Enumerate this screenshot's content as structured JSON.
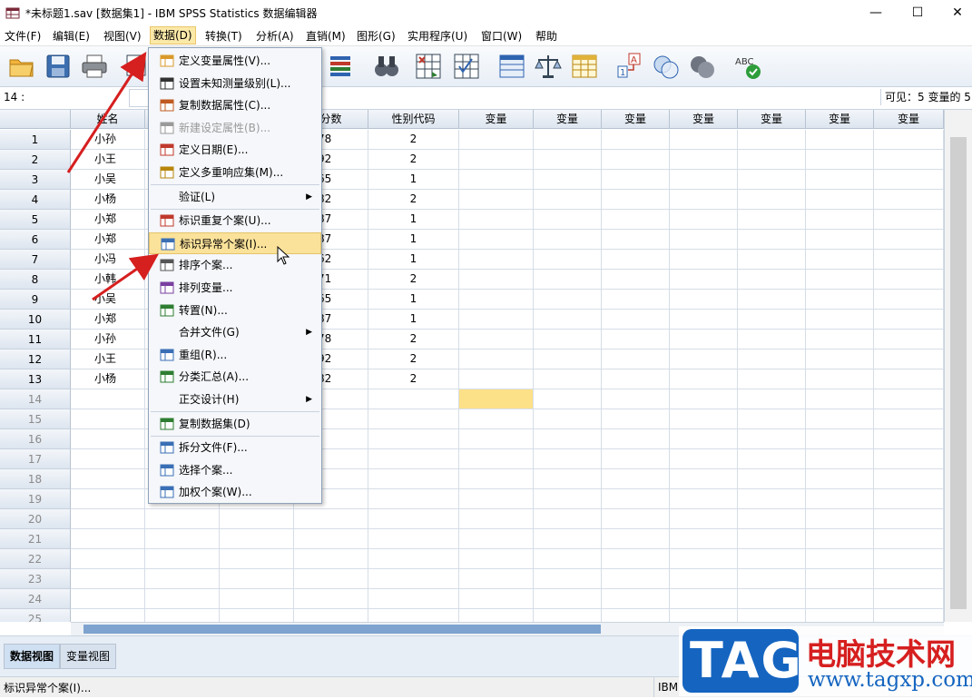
{
  "window": {
    "title": "*未标题1.sav [数据集1] - IBM SPSS Statistics 数据编辑器",
    "minimize_glyph": "—",
    "maximize_glyph": "☐",
    "close_glyph": "✕"
  },
  "menubar": {
    "items": [
      "文件(F)",
      "编辑(E)",
      "视图(V)",
      "数据(D)",
      "转换(T)",
      "分析(A)",
      "直销(M)",
      "图形(G)",
      "实用程序(U)",
      "窗口(W)",
      "帮助"
    ]
  },
  "refbar": {
    "cell_ref": "14 :",
    "visible": "可见：5 变量的 5"
  },
  "grid": {
    "headers": [
      "姓名",
      "",
      "",
      "分数",
      "性别代码",
      "变量",
      "变量",
      "变量",
      "变量",
      "变量",
      "变量",
      "变量"
    ],
    "rows": [
      {
        "num": "1",
        "name": "小孙",
        "score": "78",
        "gender": "2"
      },
      {
        "num": "2",
        "name": "小王",
        "score": "92",
        "gender": "2"
      },
      {
        "num": "3",
        "name": "小吴",
        "score": "65",
        "gender": "1"
      },
      {
        "num": "4",
        "name": "小杨",
        "score": "82",
        "gender": "2"
      },
      {
        "num": "5",
        "name": "小郑",
        "score": "87",
        "gender": "1"
      },
      {
        "num": "6",
        "name": "小郑",
        "score": "87",
        "gender": "1"
      },
      {
        "num": "7",
        "name": "小冯",
        "score": "62",
        "gender": "1"
      },
      {
        "num": "8",
        "name": "小韩",
        "score": "71",
        "gender": "2"
      },
      {
        "num": "9",
        "name": "小吴",
        "score": "65",
        "gender": "1"
      },
      {
        "num": "10",
        "name": "小郑",
        "score": "87",
        "gender": "1"
      },
      {
        "num": "11",
        "name": "小孙",
        "score": "78",
        "gender": "2"
      },
      {
        "num": "12",
        "name": "小王",
        "score": "92",
        "gender": "2"
      },
      {
        "num": "13",
        "name": "小杨",
        "score": "82",
        "gender": "2"
      }
    ],
    "empty_rows": [
      "14",
      "15",
      "16",
      "17",
      "18",
      "19",
      "20",
      "21",
      "22",
      "23",
      "24",
      "25"
    ]
  },
  "dropdown": {
    "items": [
      {
        "label": "定义变量属性(V)...",
        "icon": "define-var-icon",
        "color": "#d99a2b"
      },
      {
        "label": "设置未知测量级别(L)...",
        "icon": "unknown-measure-icon",
        "color": "#333333"
      },
      {
        "label": "复制数据属性(C)...",
        "icon": "copy-props-icon",
        "color": "#c05a20"
      },
      {
        "label": "新建设定属性(B)...",
        "icon": "new-attr-icon",
        "color": "#9a9a9a",
        "disabled": true
      },
      {
        "label": "定义日期(E)...",
        "icon": "define-date-icon",
        "color": "#c0392b"
      },
      {
        "label": "定义多重响应集(M)...",
        "icon": "multi-response-icon",
        "color": "#b8860b"
      },
      {
        "label": "验证(L)",
        "icon": "",
        "color": "",
        "submenu": true
      },
      {
        "label": "标识重复个案(U)...",
        "icon": "duplicate-cases-icon",
        "color": "#c0392b"
      },
      {
        "label": "标识异常个案(I)...",
        "icon": "unusual-cases-icon",
        "color": "#3a6fb5",
        "highlighted": true
      },
      {
        "label": "排序个案...",
        "icon": "sort-cases-icon",
        "color": "#555555"
      },
      {
        "label": "排列变量...",
        "icon": "sort-vars-icon",
        "color": "#7a3fa0"
      },
      {
        "label": "转置(N)...",
        "icon": "transpose-icon",
        "color": "#2e7d32"
      },
      {
        "label": "合并文件(G)",
        "icon": "",
        "color": "",
        "submenu": true
      },
      {
        "label": "重组(R)...",
        "icon": "restructure-icon",
        "color": "#3a6fb5"
      },
      {
        "label": "分类汇总(A)...",
        "icon": "aggregate-icon",
        "color": "#2e7d32"
      },
      {
        "label": "正交设计(H)",
        "icon": "",
        "color": "",
        "submenu": true
      },
      {
        "label": "复制数据集(D)",
        "icon": "copy-dataset-icon",
        "color": "#2e7d32"
      },
      {
        "label": "拆分文件(F)...",
        "icon": "split-file-icon",
        "color": "#3a6fb5"
      },
      {
        "label": "选择个案...",
        "icon": "select-cases-icon",
        "color": "#3a6fb5"
      },
      {
        "label": "加权个案(W)...",
        "icon": "weight-cases-icon",
        "color": "#3a6fb5"
      }
    ],
    "submenu_arrow": "▶"
  },
  "tabs": {
    "data_view": "数据视图",
    "variable_view": "变量视图"
  },
  "status": {
    "text": "标识异常个案(I)...",
    "ibm": "IBM"
  },
  "watermark": {
    "logo": "TAG",
    "site_name": "电脑技术网",
    "url": "www.tagxp.com"
  },
  "colors": {
    "accent_red": "#d61f1f",
    "highlight": "#fbe29a",
    "selected_cell": "#fde189",
    "watermark_blue": "#1565c0"
  }
}
